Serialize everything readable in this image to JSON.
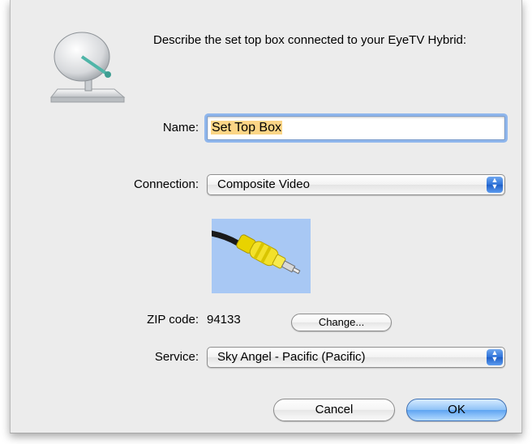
{
  "dialog": {
    "prompt": "Describe the set top box connected to your EyeTV Hybrid:"
  },
  "name": {
    "label": "Name:",
    "value": "Set Top Box"
  },
  "connection": {
    "label": "Connection:",
    "selected": "Composite Video"
  },
  "zip": {
    "label": "ZIP code:",
    "value": "94133",
    "change_label": "Change..."
  },
  "service": {
    "label": "Service:",
    "selected": "Sky Angel - Pacific (Pacific)"
  },
  "buttons": {
    "cancel_label": "Cancel",
    "ok_label": "OK"
  },
  "icons": {
    "dialog_icon": "satellite-dish-icon",
    "connector_image": "rca-connector-icon",
    "popup_arrows": "up-down-arrows-icon"
  },
  "colors": {
    "selection_highlight": "#fbd586",
    "focus_ring": "#8fb6ec",
    "default_button": "#5ea4f2",
    "connector_background": "#a8c8f4",
    "connector_plug": "#f3e12a"
  }
}
